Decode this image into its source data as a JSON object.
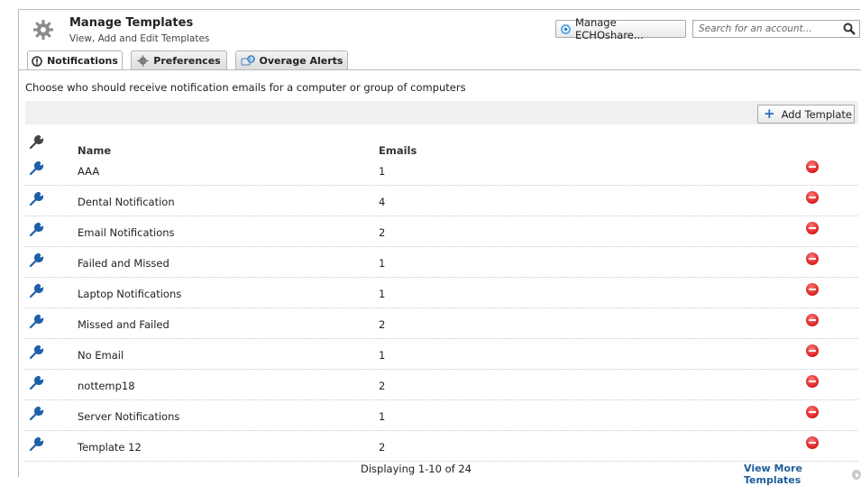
{
  "header": {
    "title": "Manage Templates",
    "subtitle": "View, Add and Edit Templates",
    "echoshare_label": "Manage ECHOshare...",
    "search_placeholder": "Search for an account..."
  },
  "tabs": [
    {
      "label": "Notifications",
      "icon": "notification-icon",
      "active": true
    },
    {
      "label": "Preferences",
      "icon": "gear-icon",
      "active": false
    },
    {
      "label": "Overage Alerts",
      "icon": "alert-icon",
      "active": false
    }
  ],
  "description": "Choose who should receive notification emails for a computer or group of computers",
  "toolbar": {
    "add_label": "Add Template"
  },
  "table": {
    "columns": [
      "Name",
      "Emails"
    ],
    "rows": [
      {
        "name": "AAA",
        "emails": "1"
      },
      {
        "name": "Dental Notification",
        "emails": "4"
      },
      {
        "name": "Email Notifications",
        "emails": "2"
      },
      {
        "name": "Failed and Missed",
        "emails": "1"
      },
      {
        "name": "Laptop Notifications",
        "emails": "1"
      },
      {
        "name": "Missed and Failed",
        "emails": "2"
      },
      {
        "name": "No Email",
        "emails": "1"
      },
      {
        "name": "nottemp18",
        "emails": "2"
      },
      {
        "name": "Server Notifications",
        "emails": "1"
      },
      {
        "name": "Template 12",
        "emails": "2"
      }
    ]
  },
  "footer": {
    "displaying": "Displaying 1-10 of 24",
    "more_label": "View More Templates"
  },
  "colors": {
    "accent": "#1f5d9c",
    "delete": "#d81c1c",
    "toolbar_bg": "#f0f0f0"
  }
}
